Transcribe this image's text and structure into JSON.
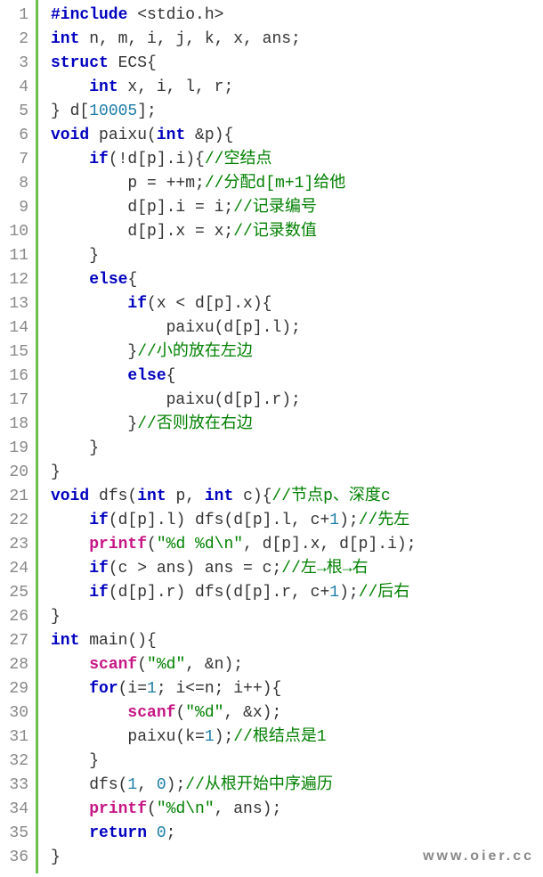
{
  "watermark": "www.oier.cc",
  "lines": [
    {
      "n": "1",
      "t": [
        {
          "c": "kw",
          "s": "#include"
        },
        {
          "c": "",
          "s": " <stdio.h>"
        }
      ]
    },
    {
      "n": "2",
      "t": [
        {
          "c": "kw",
          "s": "int"
        },
        {
          "c": "",
          "s": " n, m, i, j, k, x, ans;"
        }
      ]
    },
    {
      "n": "3",
      "t": [
        {
          "c": "kw",
          "s": "struct"
        },
        {
          "c": "",
          "s": " ECS{"
        }
      ]
    },
    {
      "n": "4",
      "t": [
        {
          "c": "",
          "s": "    "
        },
        {
          "c": "kw",
          "s": "int"
        },
        {
          "c": "",
          "s": " x, i, l, r;"
        }
      ]
    },
    {
      "n": "5",
      "t": [
        {
          "c": "",
          "s": "} d["
        },
        {
          "c": "num",
          "s": "10005"
        },
        {
          "c": "",
          "s": "];"
        }
      ]
    },
    {
      "n": "6",
      "t": [
        {
          "c": "kw",
          "s": "void"
        },
        {
          "c": "",
          "s": " paixu("
        },
        {
          "c": "kw",
          "s": "int"
        },
        {
          "c": "",
          "s": " &p){"
        }
      ]
    },
    {
      "n": "7",
      "t": [
        {
          "c": "",
          "s": "    "
        },
        {
          "c": "kw",
          "s": "if"
        },
        {
          "c": "",
          "s": "(!d[p].i){"
        },
        {
          "c": "cmt",
          "s": "//空结点"
        }
      ]
    },
    {
      "n": "8",
      "t": [
        {
          "c": "",
          "s": "        p = ++m;"
        },
        {
          "c": "cmt",
          "s": "//分配d[m+1]给他"
        }
      ]
    },
    {
      "n": "9",
      "t": [
        {
          "c": "",
          "s": "        d[p].i = i;"
        },
        {
          "c": "cmt",
          "s": "//记录编号"
        }
      ]
    },
    {
      "n": "10",
      "t": [
        {
          "c": "",
          "s": "        d[p].x = x;"
        },
        {
          "c": "cmt",
          "s": "//记录数值"
        }
      ]
    },
    {
      "n": "11",
      "t": [
        {
          "c": "",
          "s": "    }"
        }
      ]
    },
    {
      "n": "12",
      "t": [
        {
          "c": "",
          "s": "    "
        },
        {
          "c": "kw",
          "s": "else"
        },
        {
          "c": "",
          "s": "{"
        }
      ]
    },
    {
      "n": "13",
      "t": [
        {
          "c": "",
          "s": "        "
        },
        {
          "c": "kw",
          "s": "if"
        },
        {
          "c": "",
          "s": "(x < d[p].x){"
        }
      ]
    },
    {
      "n": "14",
      "t": [
        {
          "c": "",
          "s": "            paixu(d[p].l);"
        }
      ]
    },
    {
      "n": "15",
      "t": [
        {
          "c": "",
          "s": "        }"
        },
        {
          "c": "cmt",
          "s": "//小的放在左边"
        }
      ]
    },
    {
      "n": "16",
      "t": [
        {
          "c": "",
          "s": "        "
        },
        {
          "c": "kw",
          "s": "else"
        },
        {
          "c": "",
          "s": "{"
        }
      ]
    },
    {
      "n": "17",
      "t": [
        {
          "c": "",
          "s": "            paixu(d[p].r);"
        }
      ]
    },
    {
      "n": "18",
      "t": [
        {
          "c": "",
          "s": "        }"
        },
        {
          "c": "cmt",
          "s": "//否则放在右边"
        }
      ]
    },
    {
      "n": "19",
      "t": [
        {
          "c": "",
          "s": "    }"
        }
      ]
    },
    {
      "n": "20",
      "t": [
        {
          "c": "",
          "s": "}"
        }
      ]
    },
    {
      "n": "21",
      "t": [
        {
          "c": "kw",
          "s": "void"
        },
        {
          "c": "",
          "s": " dfs("
        },
        {
          "c": "kw",
          "s": "int"
        },
        {
          "c": "",
          "s": " p, "
        },
        {
          "c": "kw",
          "s": "int"
        },
        {
          "c": "",
          "s": " c){"
        },
        {
          "c": "cmt",
          "s": "//节点p、深度c"
        }
      ]
    },
    {
      "n": "22",
      "t": [
        {
          "c": "",
          "s": "    "
        },
        {
          "c": "kw",
          "s": "if"
        },
        {
          "c": "",
          "s": "(d[p].l) dfs(d[p].l, c+"
        },
        {
          "c": "num",
          "s": "1"
        },
        {
          "c": "",
          "s": ");"
        },
        {
          "c": "cmt",
          "s": "//先左"
        }
      ]
    },
    {
      "n": "23",
      "t": [
        {
          "c": "",
          "s": "    "
        },
        {
          "c": "fn",
          "s": "printf"
        },
        {
          "c": "",
          "s": "("
        },
        {
          "c": "str",
          "s": "\"%d %d\\n\""
        },
        {
          "c": "",
          "s": ", d[p].x, d[p].i);"
        }
      ]
    },
    {
      "n": "24",
      "t": [
        {
          "c": "",
          "s": "    "
        },
        {
          "c": "kw",
          "s": "if"
        },
        {
          "c": "",
          "s": "(c > ans) ans = c;"
        },
        {
          "c": "cmt",
          "s": "//左→根→右"
        }
      ]
    },
    {
      "n": "25",
      "t": [
        {
          "c": "",
          "s": "    "
        },
        {
          "c": "kw",
          "s": "if"
        },
        {
          "c": "",
          "s": "(d[p].r) dfs(d[p].r, c+"
        },
        {
          "c": "num",
          "s": "1"
        },
        {
          "c": "",
          "s": ");"
        },
        {
          "c": "cmt",
          "s": "//后右"
        }
      ]
    },
    {
      "n": "26",
      "t": [
        {
          "c": "",
          "s": "}"
        }
      ]
    },
    {
      "n": "27",
      "t": [
        {
          "c": "kw",
          "s": "int"
        },
        {
          "c": "",
          "s": " main(){"
        }
      ]
    },
    {
      "n": "28",
      "t": [
        {
          "c": "",
          "s": "    "
        },
        {
          "c": "fn",
          "s": "scanf"
        },
        {
          "c": "",
          "s": "("
        },
        {
          "c": "str",
          "s": "\"%d\""
        },
        {
          "c": "",
          "s": ", &n);"
        }
      ]
    },
    {
      "n": "29",
      "t": [
        {
          "c": "",
          "s": "    "
        },
        {
          "c": "kw",
          "s": "for"
        },
        {
          "c": "",
          "s": "(i="
        },
        {
          "c": "num",
          "s": "1"
        },
        {
          "c": "",
          "s": "; i<=n; i++){"
        }
      ]
    },
    {
      "n": "30",
      "t": [
        {
          "c": "",
          "s": "        "
        },
        {
          "c": "fn",
          "s": "scanf"
        },
        {
          "c": "",
          "s": "("
        },
        {
          "c": "str",
          "s": "\"%d\""
        },
        {
          "c": "",
          "s": ", &x);"
        }
      ]
    },
    {
      "n": "31",
      "t": [
        {
          "c": "",
          "s": "        paixu(k="
        },
        {
          "c": "num",
          "s": "1"
        },
        {
          "c": "",
          "s": ");"
        },
        {
          "c": "cmt",
          "s": "//根结点是1"
        }
      ]
    },
    {
      "n": "32",
      "t": [
        {
          "c": "",
          "s": "    }"
        }
      ]
    },
    {
      "n": "33",
      "t": [
        {
          "c": "",
          "s": "    dfs("
        },
        {
          "c": "num",
          "s": "1"
        },
        {
          "c": "",
          "s": ", "
        },
        {
          "c": "num",
          "s": "0"
        },
        {
          "c": "",
          "s": ");"
        },
        {
          "c": "cmt",
          "s": "//从根开始中序遍历"
        }
      ]
    },
    {
      "n": "34",
      "t": [
        {
          "c": "",
          "s": "    "
        },
        {
          "c": "fn",
          "s": "printf"
        },
        {
          "c": "",
          "s": "("
        },
        {
          "c": "str",
          "s": "\"%d\\n\""
        },
        {
          "c": "",
          "s": ", ans);"
        }
      ]
    },
    {
      "n": "35",
      "t": [
        {
          "c": "",
          "s": "    "
        },
        {
          "c": "kw",
          "s": "return"
        },
        {
          "c": "",
          "s": " "
        },
        {
          "c": "num",
          "s": "0"
        },
        {
          "c": "",
          "s": ";"
        }
      ]
    },
    {
      "n": "36",
      "t": [
        {
          "c": "",
          "s": "}"
        }
      ]
    }
  ]
}
